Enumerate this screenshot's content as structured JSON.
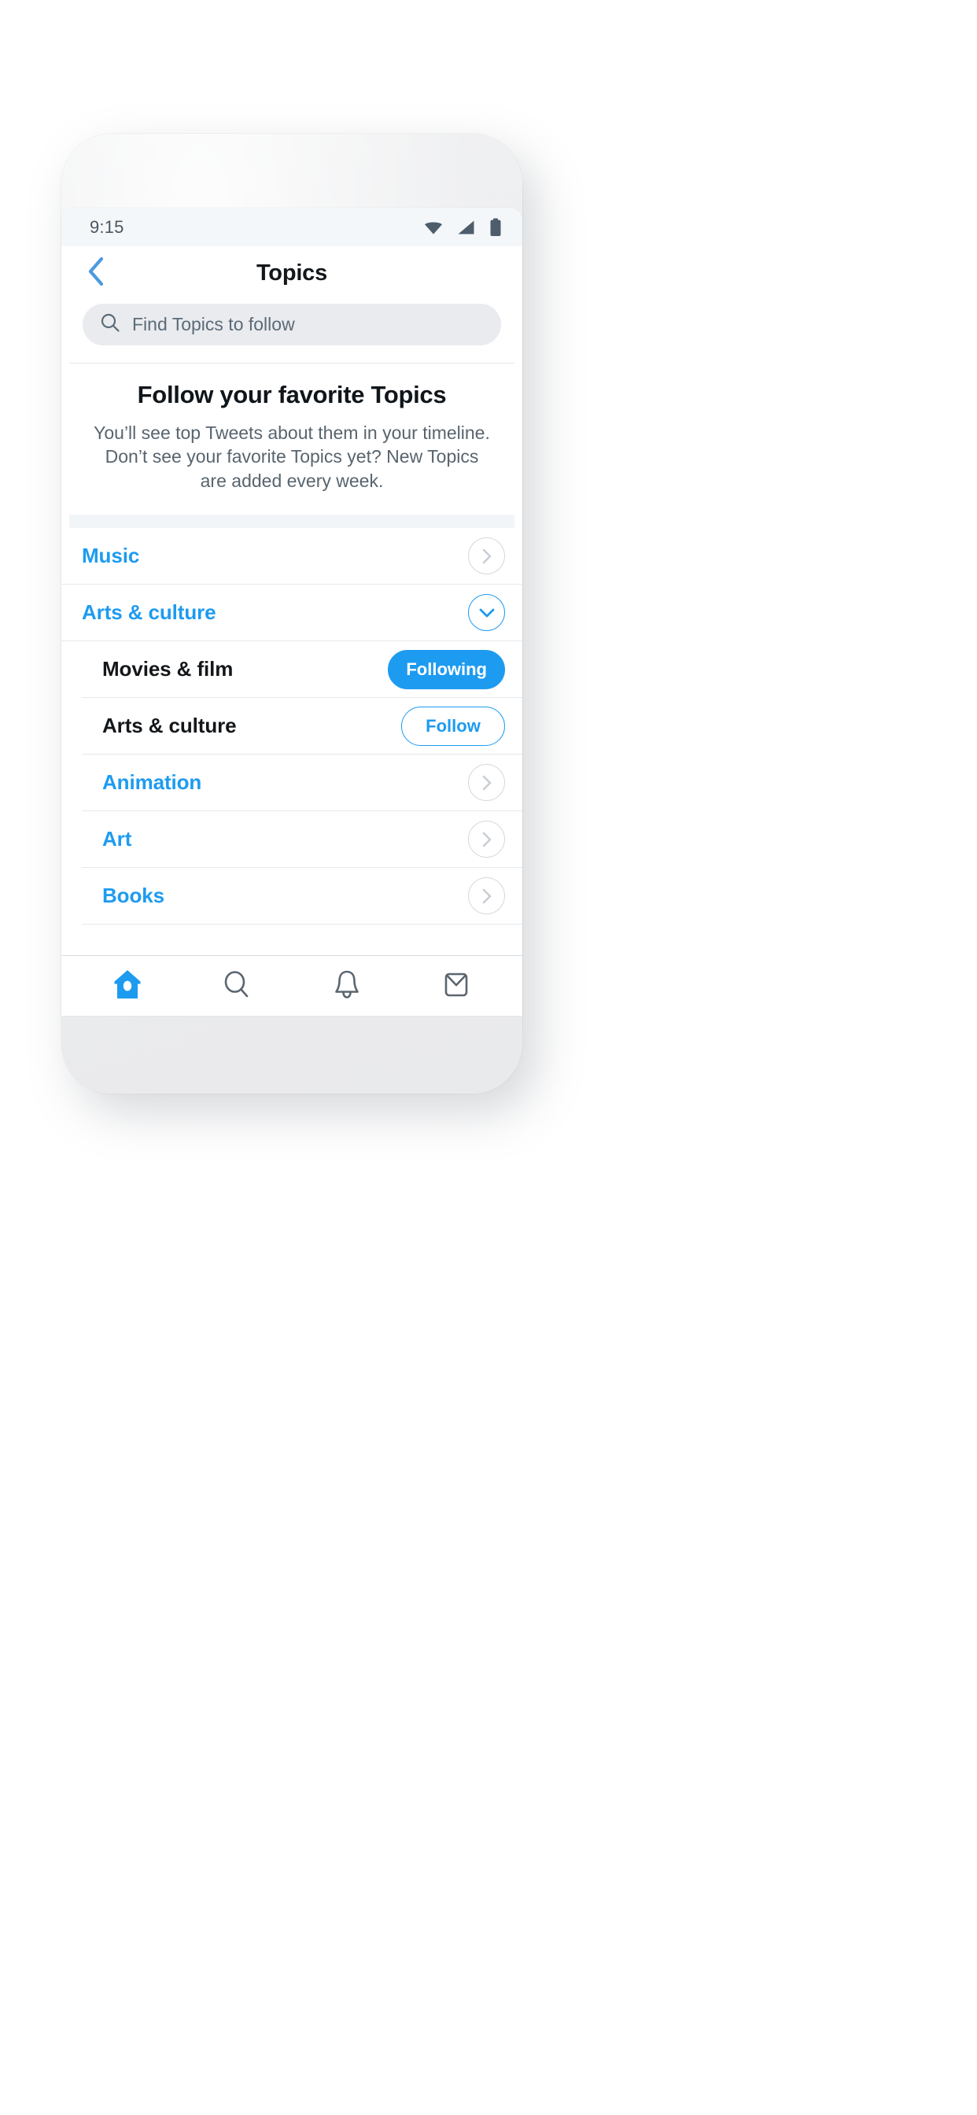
{
  "status_bar": {
    "time": "9:15",
    "icons": [
      "wifi-icon",
      "cellular-signal-icon",
      "battery-icon"
    ]
  },
  "header": {
    "back_icon": "chevron-left-icon",
    "title": "Topics"
  },
  "search": {
    "icon": "search-icon",
    "placeholder": "Find Topics to follow",
    "value": ""
  },
  "hero": {
    "title": "Follow your favorite Topics",
    "subtitle": "You’ll see top Tweets about them in your timeline. Don’t see your favorite Topics yet? New Topics are added every week."
  },
  "topics": [
    {
      "label": "Music",
      "style": "blue",
      "indent": false,
      "control": "chevron-right-circle",
      "control_accent": false
    },
    {
      "label": "Arts & culture",
      "style": "blue",
      "indent": false,
      "control": "chevron-down-circle",
      "control_accent": true
    },
    {
      "label": "Movies & film",
      "style": "dark",
      "indent": true,
      "control": "pill-following",
      "control_label": "Following"
    },
    {
      "label": "Arts & culture",
      "style": "dark",
      "indent": true,
      "control": "pill-follow",
      "control_label": "Follow"
    },
    {
      "label": "Animation",
      "style": "blue",
      "indent": true,
      "control": "chevron-right-circle",
      "control_accent": false
    },
    {
      "label": "Art",
      "style": "blue",
      "indent": true,
      "control": "chevron-right-circle",
      "control_accent": false
    },
    {
      "label": "Books",
      "style": "blue",
      "indent": true,
      "control": "chevron-right-circle",
      "control_accent": false
    }
  ],
  "tabbar": [
    {
      "icon": "home-icon",
      "active": true
    },
    {
      "icon": "search-icon",
      "active": false
    },
    {
      "icon": "notifications-bell-icon",
      "active": false
    },
    {
      "icon": "messages-envelope-icon",
      "active": false
    }
  ],
  "colors": {
    "accent": "#1d9bf0",
    "text_primary": "#14171a",
    "text_secondary": "#58646e",
    "search_bg": "#e9ebee",
    "divider": "#e6e9ec",
    "status_bg": "#f4f7f9",
    "band": "#f2f5f8"
  }
}
